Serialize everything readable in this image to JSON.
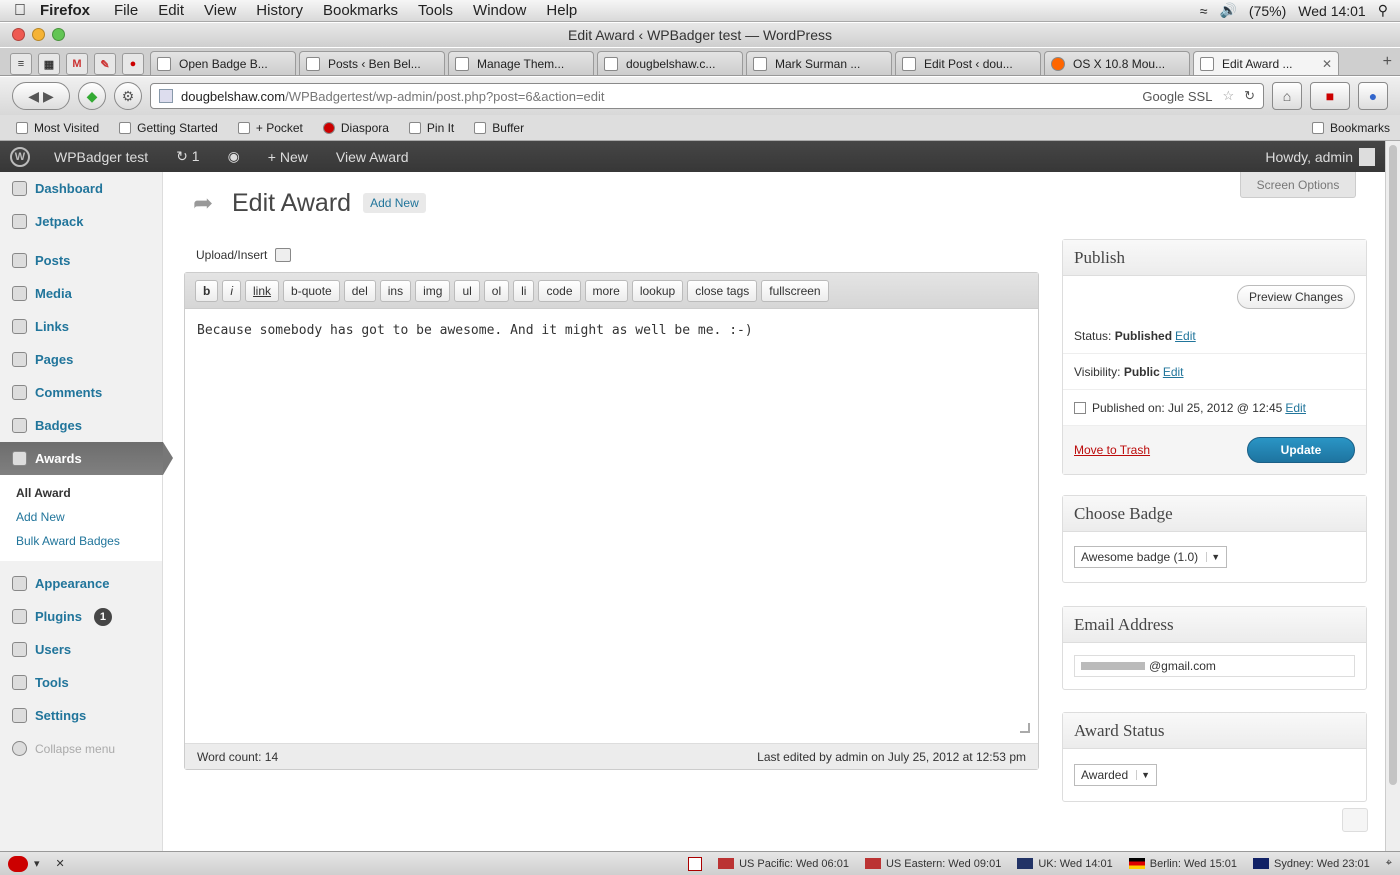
{
  "mac_menu": {
    "app": "Firefox",
    "items": [
      "File",
      "Edit",
      "View",
      "History",
      "Bookmarks",
      "Tools",
      "Window",
      "Help"
    ],
    "battery": "(75%)",
    "clock": "Wed 14:01"
  },
  "window": {
    "title": "Edit Award ‹ WPBadger test — WordPress"
  },
  "tabs": [
    {
      "label": "Open Badge B..."
    },
    {
      "label": "Posts ‹ Ben Bel..."
    },
    {
      "label": "Manage Them..."
    },
    {
      "label": "dougbelshaw.c..."
    },
    {
      "label": "Mark Surman ..."
    },
    {
      "label": "Edit Post ‹ dou..."
    },
    {
      "label": "OS X 10.8 Mou..."
    },
    {
      "label": "Edit Award ..."
    }
  ],
  "pinned_tabs": [
    "≡",
    "▦",
    "M",
    "✎",
    "●"
  ],
  "nav": {
    "url_domain": "dougbelshaw.com",
    "url_path": "/WPBadgertest/wp-admin/post.php?post=6&action=edit",
    "search_engine": "Google SSL"
  },
  "bookmarks": {
    "items": [
      "Most Visited",
      "Getting Started",
      "+ Pocket",
      "Diaspora",
      "Pin It",
      "Buffer"
    ],
    "menu": "Bookmarks"
  },
  "adminbar": {
    "site": "WPBadger test",
    "updates": "1",
    "new": "+ New",
    "view": "View Award",
    "howdy": "Howdy, admin"
  },
  "sidebar": {
    "top": [
      "Dashboard",
      "Jetpack"
    ],
    "mid": [
      "Posts",
      "Media",
      "Links",
      "Pages",
      "Comments",
      "Badges"
    ],
    "current": "Awards",
    "sub": [
      "All Award",
      "Add New",
      "Bulk Award Badges"
    ],
    "bottom": [
      "Appearance",
      "Plugins",
      "Users",
      "Tools",
      "Settings"
    ],
    "plugins_count": "1",
    "collapse": "Collapse menu"
  },
  "screen_options": "Screen Options",
  "page": {
    "title": "Edit Award",
    "add_new": "Add New",
    "upload": "Upload/Insert"
  },
  "quicktags": [
    "b",
    "i",
    "link",
    "b-quote",
    "del",
    "ins",
    "img",
    "ul",
    "ol",
    "li",
    "code",
    "more",
    "lookup",
    "close tags",
    "fullscreen"
  ],
  "editor": {
    "content": "Because somebody has got to be awesome. And it might as well be me. :-)",
    "word_count": "Word count: 14",
    "last_edited": "Last edited by admin on July 25, 2012 at 12:53 pm"
  },
  "publish": {
    "title": "Publish",
    "preview": "Preview Changes",
    "status_label": "Status:",
    "status_value": "Published",
    "visibility_label": "Visibility:",
    "visibility_value": "Public",
    "published_on": "Published on: Jul 25, 2012 @ 12:45",
    "edit": "Edit",
    "trash": "Move to Trash",
    "update": "Update"
  },
  "choose_badge": {
    "title": "Choose Badge",
    "selected": "Awesome badge (1.0)"
  },
  "email": {
    "title": "Email Address",
    "value": "@gmail.com"
  },
  "award_status": {
    "title": "Award Status",
    "selected": "Awarded"
  },
  "clocks": [
    "US Pacific: Wed 06:01",
    "US Eastern: Wed 09:01",
    "UK: Wed 14:01",
    "Berlin: Wed 15:01",
    "Sydney: Wed 23:01"
  ]
}
